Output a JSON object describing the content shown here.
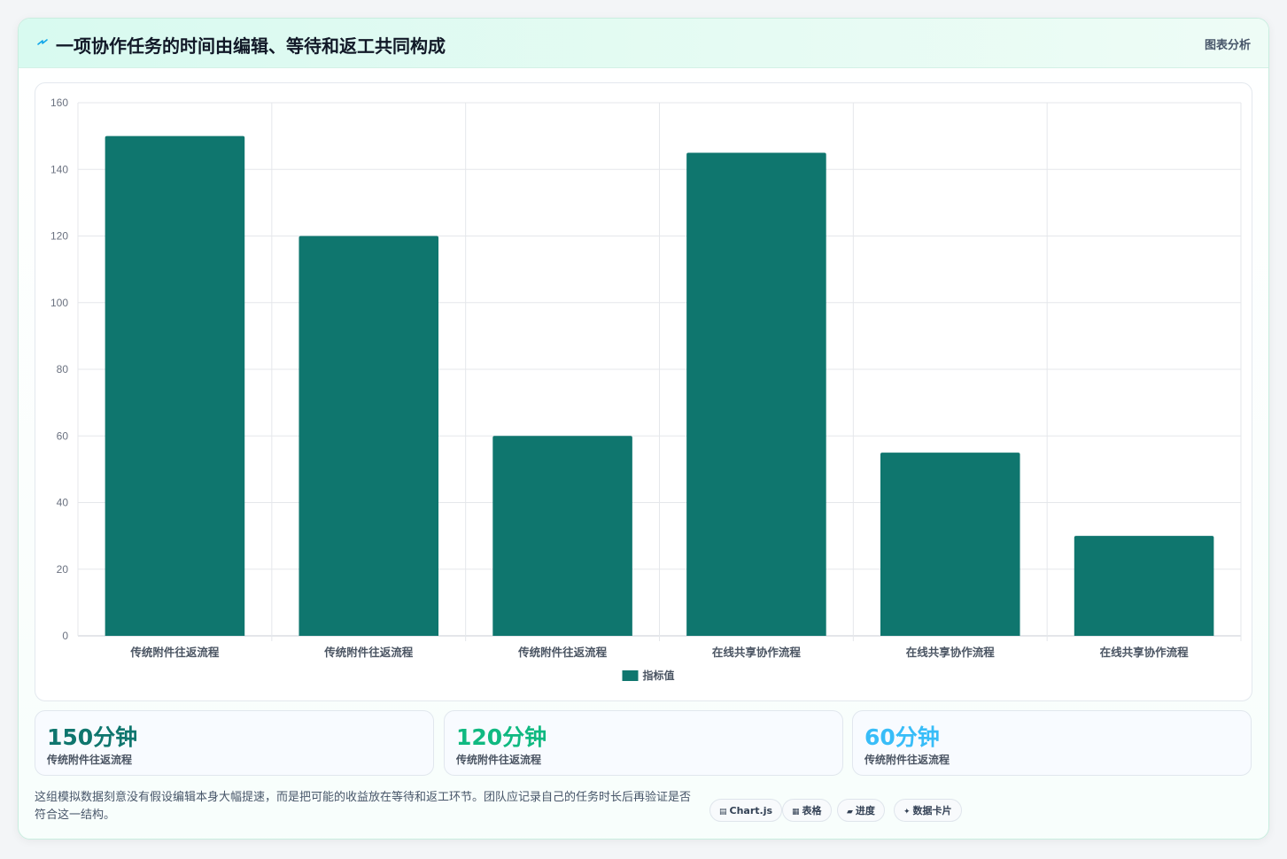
{
  "header": {
    "title": "一项协作任务的时间由编辑、等待和返工共同构成",
    "tag": "图表分析",
    "accent": "#0ea5e9"
  },
  "chart_data": {
    "type": "bar",
    "categories": [
      "传统附件往返流程",
      "传统附件往返流程",
      "传统附件往返流程",
      "在线共享协作流程",
      "在线共享协作流程",
      "在线共享协作流程"
    ],
    "series": [
      {
        "name": "指标值",
        "values": [
          150,
          120,
          60,
          145,
          55,
          30
        ],
        "color": "#0f766e"
      }
    ],
    "ylim": [
      0,
      160
    ],
    "yticks": [
      0,
      20,
      40,
      60,
      80,
      100,
      120,
      140,
      160
    ],
    "grid": true,
    "legend": "bottom"
  },
  "stats": [
    {
      "value": "150分钟",
      "label": "传统附件往返流程",
      "color": "#0f766e"
    },
    {
      "value": "120分钟",
      "label": "传统附件往返流程",
      "color": "#10b981"
    },
    {
      "value": "60分钟",
      "label": "传统附件往返流程",
      "color": "#38bdf8"
    }
  ],
  "footer": {
    "note": "这组模拟数据刻意没有假设编辑本身大幅提速，而是把可能的收益放在等待和返工环节。团队应记录自己的任务时长后再验证是否符合这一结构。",
    "chips": [
      {
        "icon": "▤",
        "label": "Chart.js"
      },
      {
        "icon": "▦",
        "label": "表格"
      },
      {
        "icon": "▰",
        "label": "进度"
      },
      {
        "icon": "✦",
        "label": "数据卡片"
      }
    ]
  }
}
